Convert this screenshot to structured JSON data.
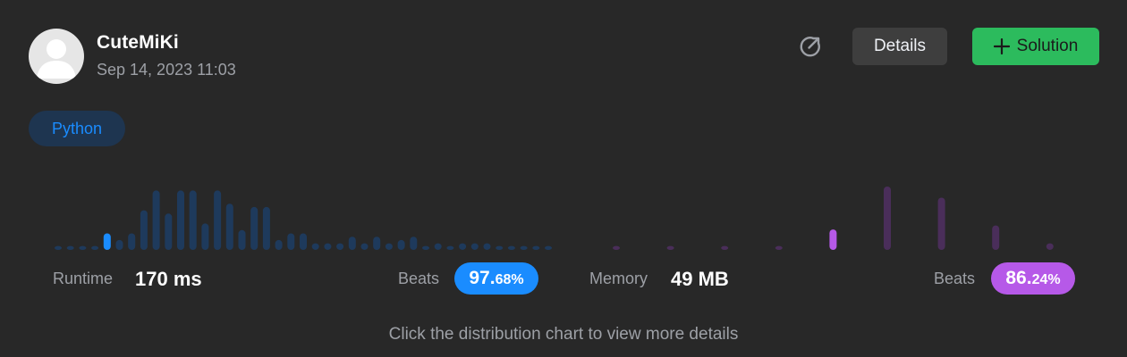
{
  "user": {
    "name": "CuteMiKi",
    "timestamp": "Sep 14, 2023 11:03"
  },
  "actions": {
    "share_icon": "share-arrow-icon",
    "details_label": "Details",
    "solution_label": "Solution"
  },
  "language_tag": "Python",
  "runtime": {
    "label": "Runtime",
    "value": "170 ms",
    "beats_label": "Beats",
    "beats_int": "97.",
    "beats_dec": "68%"
  },
  "memory": {
    "label": "Memory",
    "value": "49 MB",
    "beats_label": "Beats",
    "beats_int": "86.",
    "beats_dec": "24%"
  },
  "hint": "Click the distribution chart to view more details",
  "colors": {
    "background": "#282828",
    "runtime_bar": "#1e3a5c",
    "runtime_highlight": "#1a8cff",
    "memory_bar": "#4a2e5a",
    "memory_highlight": "#b659e8",
    "solution_green": "#2cbb5d"
  },
  "chart_data": [
    {
      "type": "bar",
      "name": "runtime-distribution",
      "values": [
        1,
        1,
        1,
        1,
        5,
        3,
        5,
        12,
        18,
        11,
        18,
        18,
        8,
        18,
        14,
        6,
        13,
        13,
        3,
        5,
        5,
        2,
        2,
        2,
        4,
        2,
        4,
        2,
        3,
        4,
        1,
        2,
        1,
        2,
        2,
        2,
        1,
        1,
        1,
        1,
        1
      ],
      "highlight_index": 4,
      "ylim": [
        0,
        20
      ]
    },
    {
      "type": "bar",
      "name": "memory-distribution",
      "values": [
        0.3,
        0.3,
        0.3,
        0.3,
        3.1,
        9.6,
        7.9,
        3.7,
        1.0
      ],
      "highlight_index": 4,
      "ylim": [
        0,
        10
      ]
    }
  ]
}
